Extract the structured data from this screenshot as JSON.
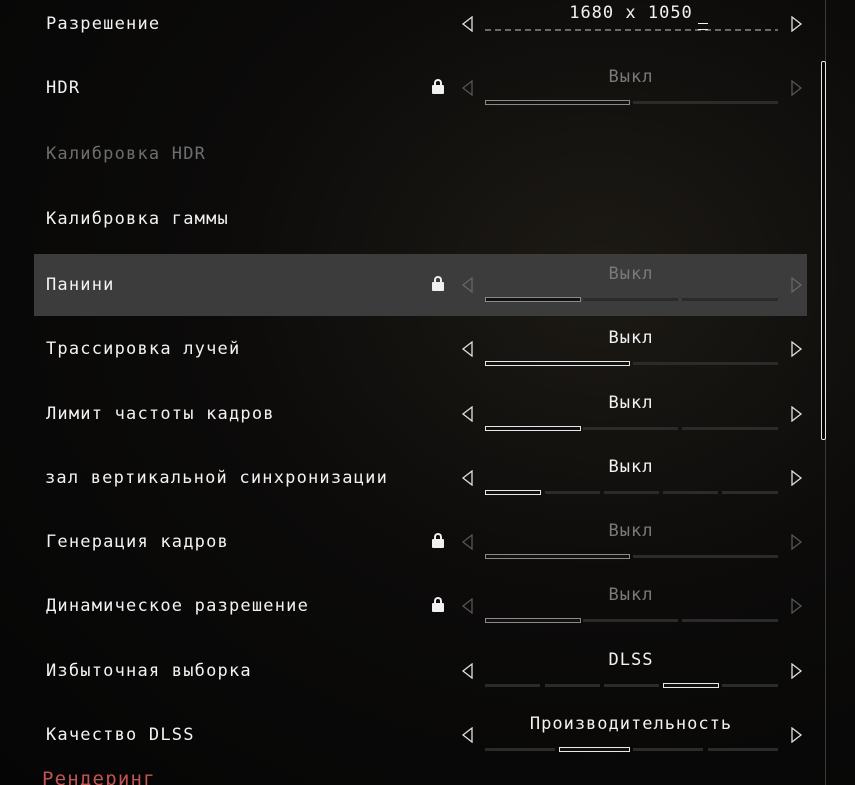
{
  "settings": [
    {
      "label": "Разрешение",
      "value": "1680 x 1050",
      "locked": false
    },
    {
      "label": "HDR",
      "value": "Выкл",
      "locked": true
    },
    {
      "label": "Калибровка HDR",
      "value": "",
      "locked": false,
      "disabled": true
    },
    {
      "label": "Калибровка гаммы",
      "value": "",
      "locked": false
    },
    {
      "label": "Панини",
      "value": "Выкл",
      "locked": true,
      "highlighted": true
    },
    {
      "label": "Трассировка лучей",
      "value": "Выкл",
      "locked": false
    },
    {
      "label": "Лимит частоты кадров",
      "value": "Выкл",
      "locked": false
    },
    {
      "label": "зал вертикальной синхронизации",
      "value": "Выкл",
      "locked": false
    },
    {
      "label": "Генерация кадров",
      "value": "Выкл",
      "locked": true
    },
    {
      "label": "Динамическое разрешение",
      "value": "Выкл",
      "locked": true
    },
    {
      "label": "Избыточная выборка",
      "value": "DLSS",
      "locked": false
    },
    {
      "label": "Качество DLSS",
      "value": "Производительность",
      "locked": false
    }
  ],
  "section_header": "Рендеринг",
  "icons": {
    "lock": "lock-icon",
    "left": "arrow-left-icon",
    "right": "arrow-right-icon"
  }
}
